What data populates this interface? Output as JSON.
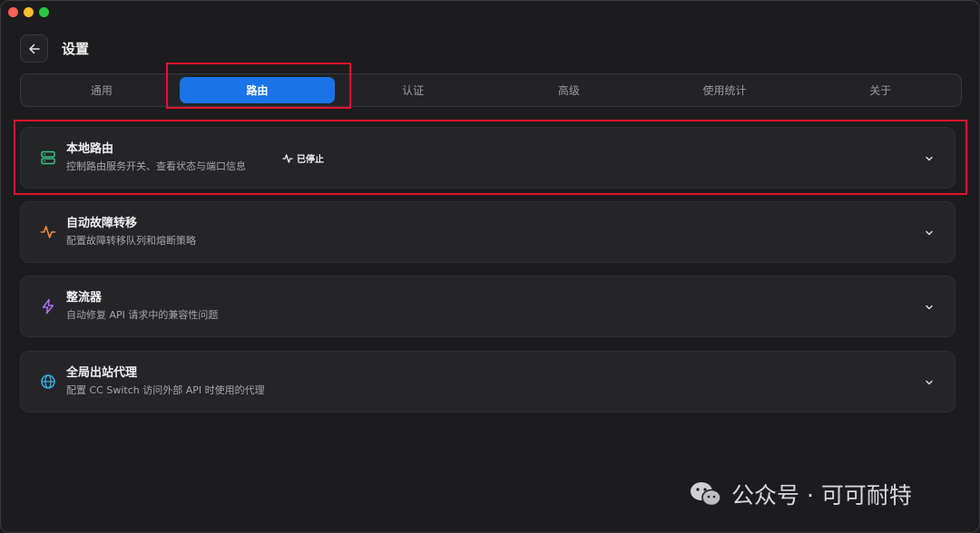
{
  "header": {
    "title": "设置"
  },
  "tabs": [
    {
      "label": "通用",
      "active": false
    },
    {
      "label": "路由",
      "active": true
    },
    {
      "label": "认证",
      "active": false
    },
    {
      "label": "高级",
      "active": false
    },
    {
      "label": "使用统计",
      "active": false
    },
    {
      "label": "关于",
      "active": false
    }
  ],
  "cards": [
    {
      "title": "本地路由",
      "desc": "控制路由服务开关、查看状态与端口信息",
      "status": "已停止",
      "icon": "server-icon",
      "icon_color": "#36c28a"
    },
    {
      "title": "自动故障转移",
      "desc": "配置故障转移队列和熔断策略",
      "icon": "activity-icon",
      "icon_color": "#f08a3c"
    },
    {
      "title": "整流器",
      "desc": "自动修复 API 请求中的兼容性问题",
      "icon": "lightning-icon",
      "icon_color": "#b06ef0"
    },
    {
      "title": "全局出站代理",
      "desc": "配置 CC Switch 访问外部 API 时使用的代理",
      "icon": "globe-icon",
      "icon_color": "#3ab0e0"
    }
  ],
  "watermark": {
    "text": "公众号 · 可可耐特"
  },
  "colors": {
    "accent": "#1a73e8",
    "highlight": "#e5122b",
    "background": "#1c1c1e"
  }
}
